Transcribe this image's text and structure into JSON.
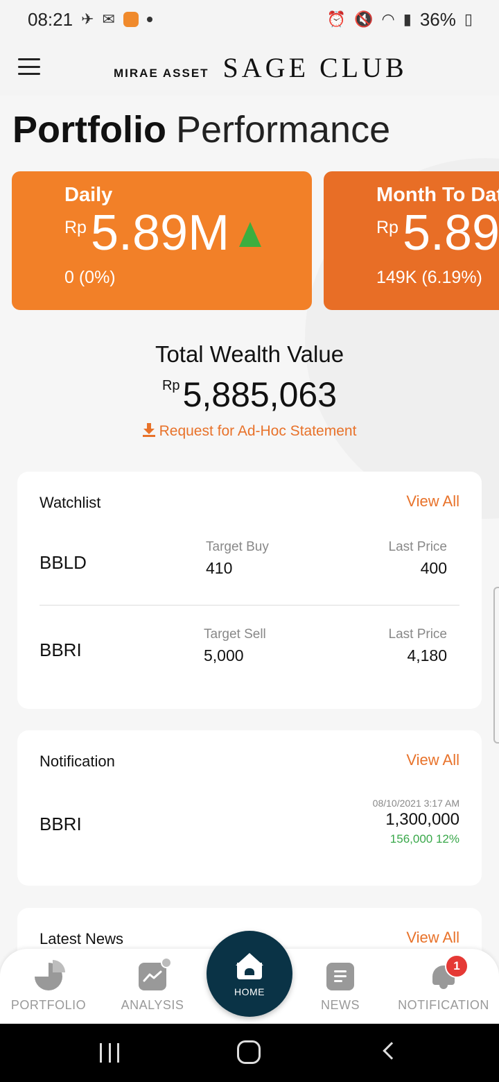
{
  "status_bar": {
    "time": "08:21",
    "battery": "36%"
  },
  "header": {
    "brand_small": "MIRAE ASSET",
    "brand_big": "SAGE CLUB"
  },
  "page_title": {
    "bold": "Portfolio",
    "light": "Performance"
  },
  "perf_cards": [
    {
      "label": "Daily",
      "currency": "Rp",
      "value": "5.89M",
      "change": "0 (0%)",
      "trend": "up"
    },
    {
      "label": "Month To Date",
      "currency": "Rp",
      "value": "5.89",
      "change": "149K (6.19%)"
    }
  ],
  "wealth": {
    "label": "Total Wealth Value",
    "currency": "Rp",
    "value": "5,885,063",
    "statement_link": "Request for Ad-Hoc Statement"
  },
  "watchlist": {
    "title": "Watchlist",
    "view_all": "View All",
    "items": [
      {
        "symbol": "BBLD",
        "target_label": "Target Buy",
        "target_value": "410",
        "last_label": "Last Price",
        "last_value": "400"
      },
      {
        "symbol": "BBRI",
        "target_label": "Target Sell",
        "target_value": "5,000",
        "last_label": "Last Price",
        "last_value": "4,180"
      }
    ]
  },
  "notification": {
    "title": "Notification",
    "view_all": "View All",
    "item": {
      "symbol": "BBRI",
      "time": "08/10/2021 3:17 AM",
      "amount": "1,300,000",
      "change": "156,000 12%"
    }
  },
  "news": {
    "title": "Latest News",
    "view_all": "View All"
  },
  "bottom_nav": {
    "portfolio": "PORTFOLIO",
    "analysis": "ANALYSIS",
    "home": "HOME",
    "news": "NEWS",
    "notification": "NOTIFICATION",
    "notification_badge": "1"
  },
  "colors": {
    "accent": "#e8722a",
    "card_daily": "#f28028",
    "card_mtd": "#e86e26",
    "home_fab": "#0a3346",
    "positive": "#39a84a"
  }
}
